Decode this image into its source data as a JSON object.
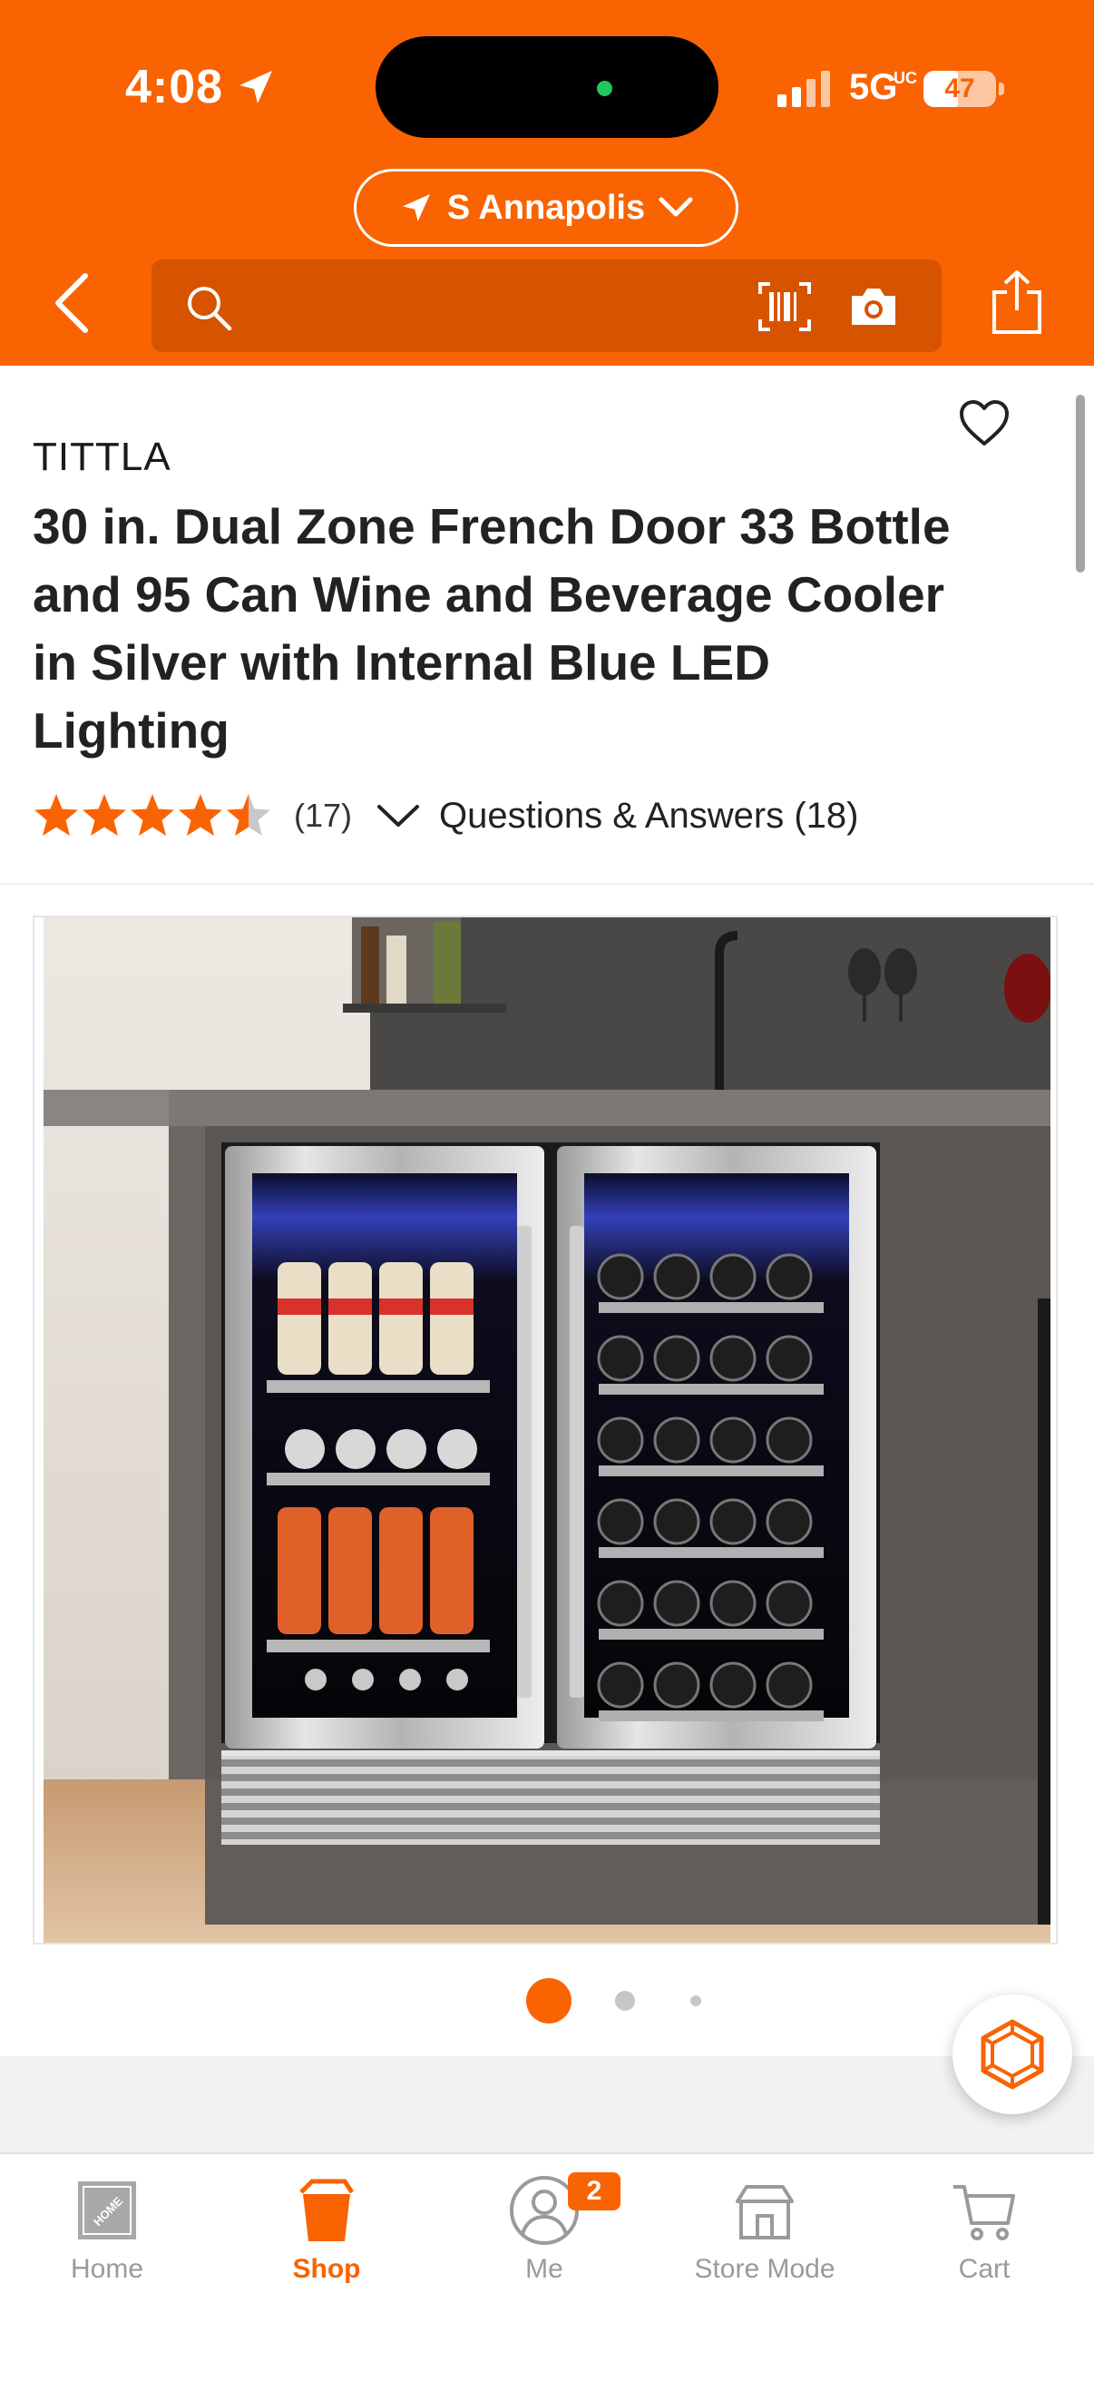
{
  "status_bar": {
    "time": "4:08",
    "network": "5G",
    "network_sub": "UC",
    "battery": "47",
    "battery_level": 0.47
  },
  "header": {
    "store_name": "S Annapolis",
    "search_placeholder": "",
    "icons": [
      "location-arrow-icon",
      "chevron-down-icon",
      "back-icon",
      "search-icon",
      "barcode-icon",
      "camera-icon",
      "share-icon"
    ],
    "accent_color": "#f96302"
  },
  "product": {
    "brand": "TITTLA",
    "title": "30 in. Dual Zone French Door 33 Bottle and 95 Can Wine and Beverage Cooler in Silver with Internal Blue LED Lighting",
    "rating": 4.5,
    "review_count": "(17)",
    "qa_label": "Questions & Answers (18)",
    "image_index": 1,
    "image_count": 3
  },
  "bottom_nav": {
    "items": [
      {
        "label": "Home",
        "icon": "home-depot-logo-icon",
        "active": false
      },
      {
        "label": "Shop",
        "icon": "shop-bucket-icon",
        "active": true
      },
      {
        "label": "Me",
        "icon": "user-icon",
        "active": false,
        "badge": "2"
      },
      {
        "label": "Store Mode",
        "icon": "store-icon",
        "active": false
      },
      {
        "label": "Cart",
        "icon": "cart-icon",
        "active": false
      }
    ]
  }
}
